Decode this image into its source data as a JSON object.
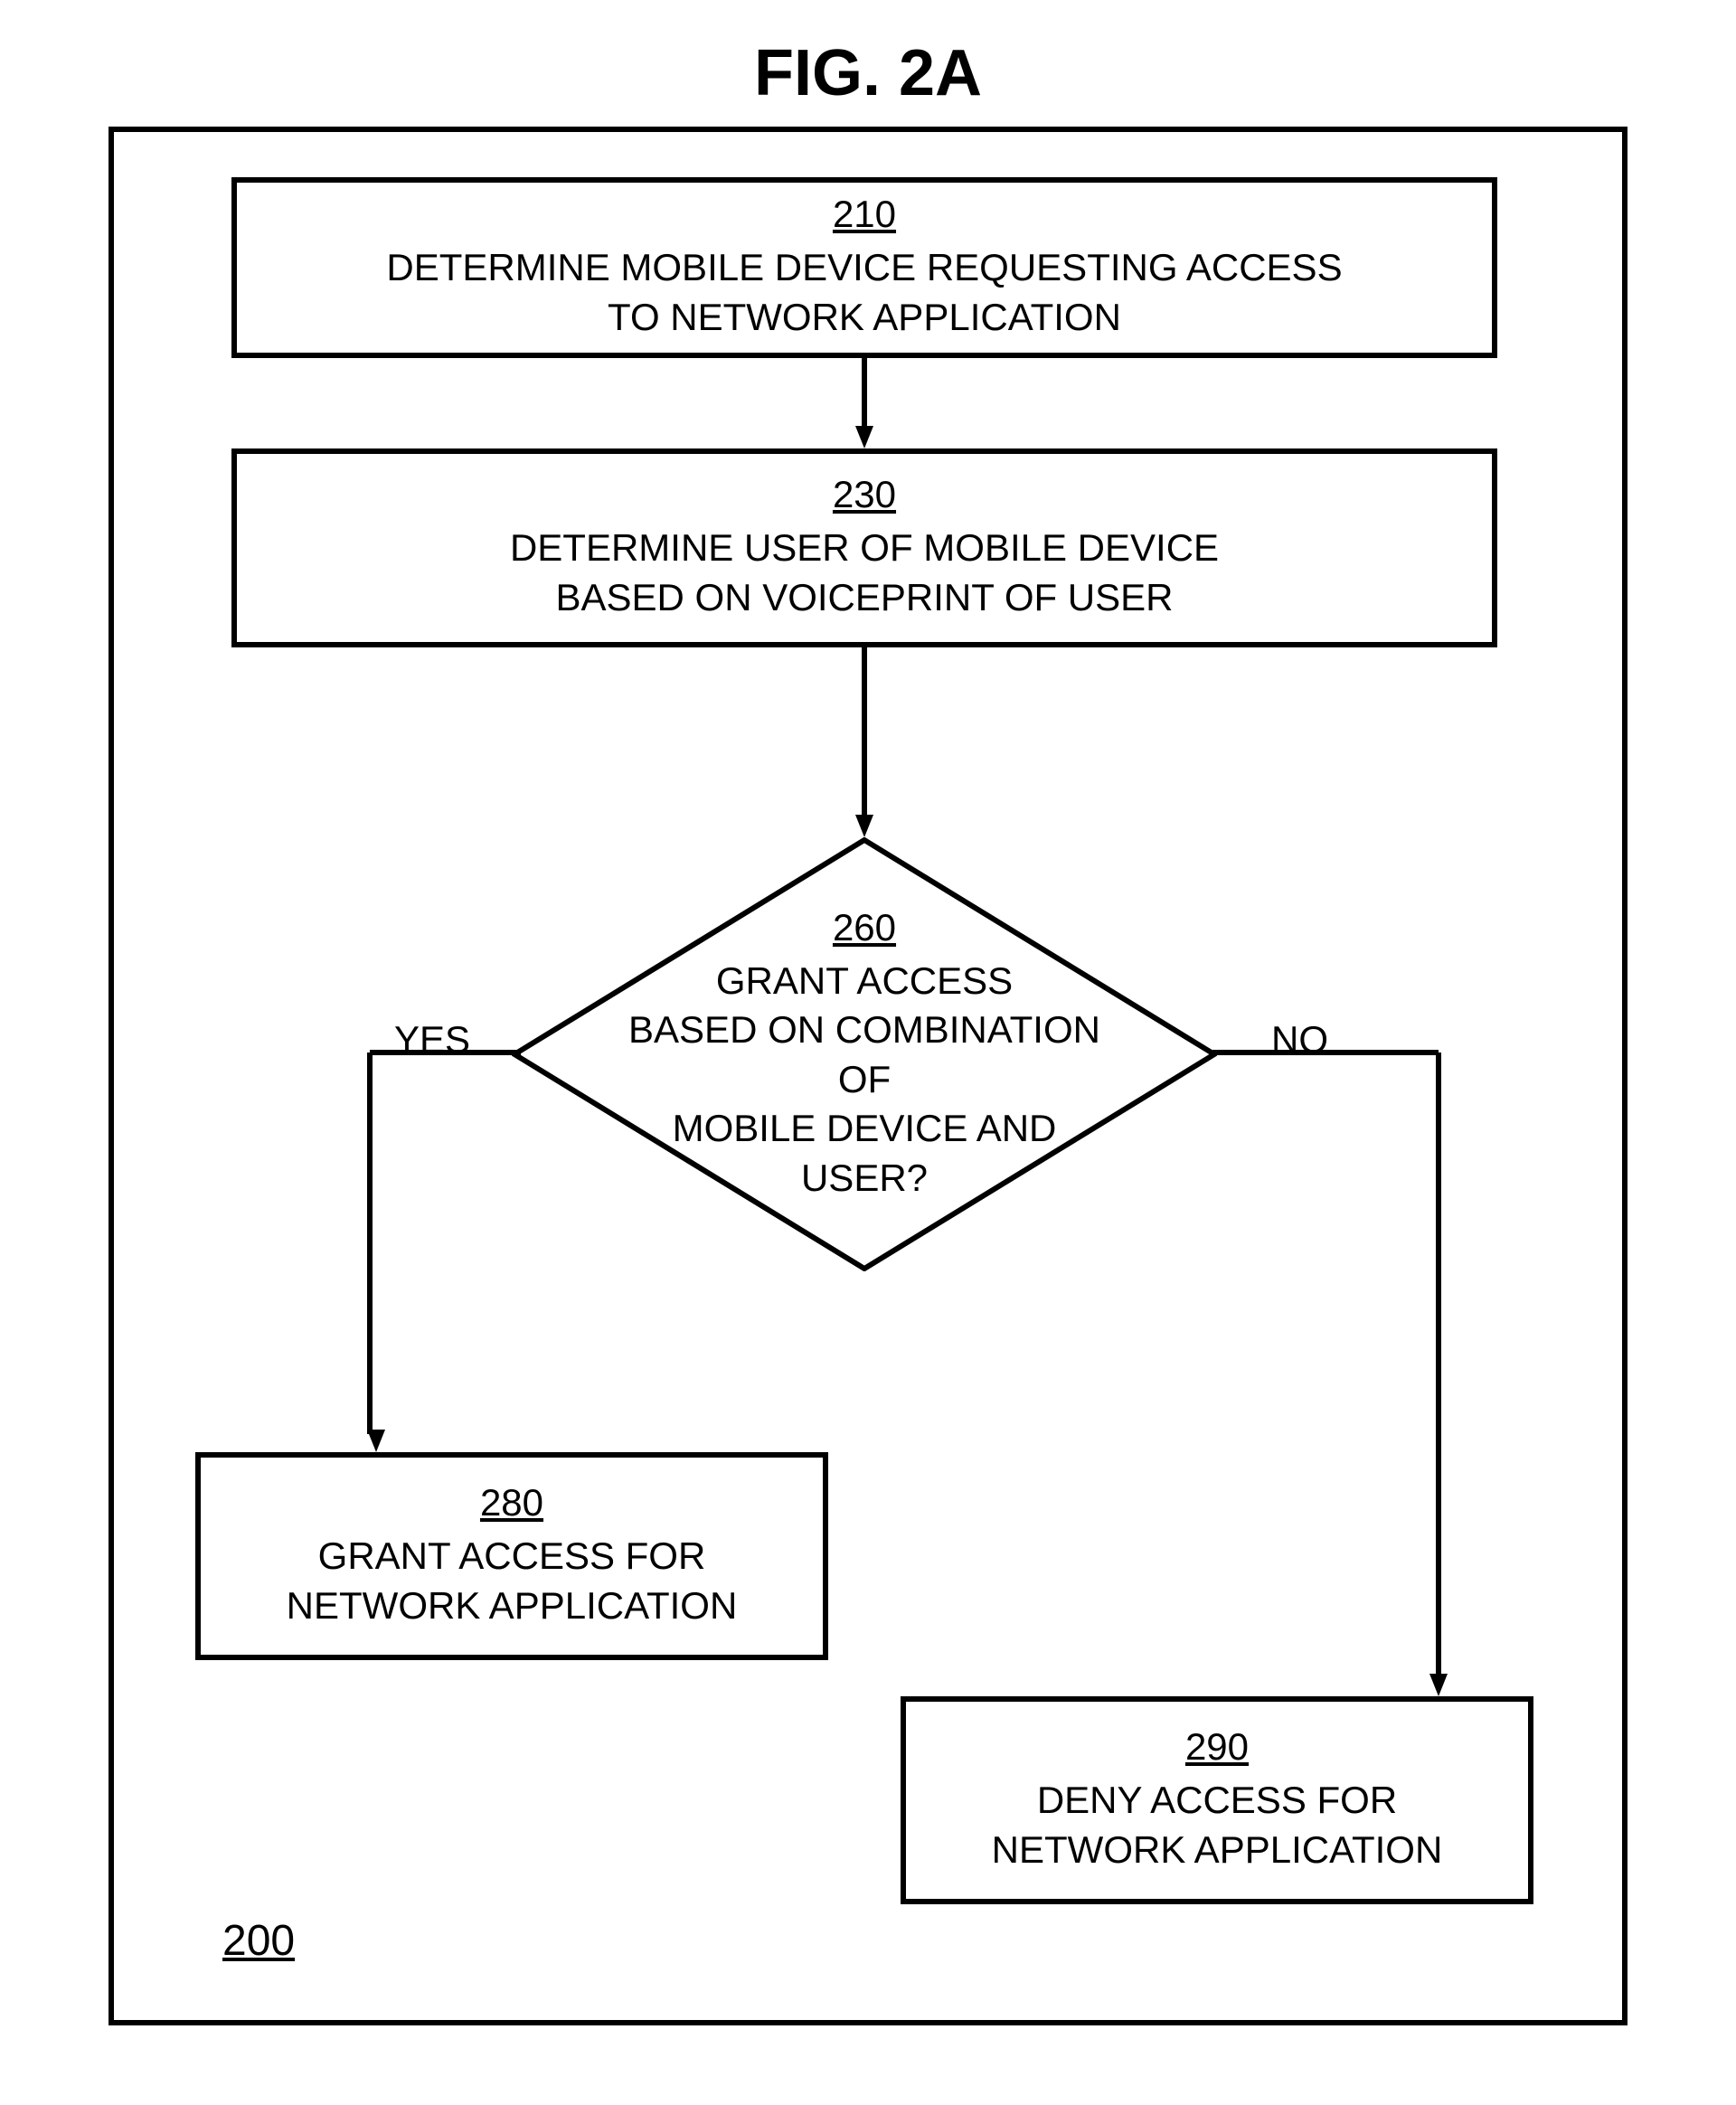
{
  "title": "FIG. 2A",
  "figure_ref": "200",
  "boxes": {
    "b210": {
      "ref": "210",
      "text": "DETERMINE MOBILE DEVICE REQUESTING ACCESS\nTO NETWORK APPLICATION"
    },
    "b230": {
      "ref": "230",
      "text": "DETERMINE USER OF MOBILE DEVICE\nBASED ON VOICEPRINT OF USER"
    },
    "b260": {
      "ref": "260",
      "text": "GRANT ACCESS\nBASED ON COMBINATION OF\nMOBILE DEVICE AND\nUSER?"
    },
    "b280": {
      "ref": "280",
      "text": "GRANT ACCESS FOR\nNETWORK APPLICATION"
    },
    "b290": {
      "ref": "290",
      "text": "DENY ACCESS FOR\nNETWORK APPLICATION"
    }
  },
  "labels": {
    "yes": "YES",
    "no": "NO"
  },
  "chart_data": {
    "type": "flowchart",
    "nodes": [
      {
        "id": "210",
        "type": "process",
        "label": "DETERMINE MOBILE DEVICE REQUESTING ACCESS TO NETWORK APPLICATION"
      },
      {
        "id": "230",
        "type": "process",
        "label": "DETERMINE USER OF MOBILE DEVICE BASED ON VOICEPRINT OF USER"
      },
      {
        "id": "260",
        "type": "decision",
        "label": "GRANT ACCESS BASED ON COMBINATION OF MOBILE DEVICE AND USER?"
      },
      {
        "id": "280",
        "type": "process",
        "label": "GRANT ACCESS FOR NETWORK APPLICATION"
      },
      {
        "id": "290",
        "type": "process",
        "label": "DENY ACCESS FOR NETWORK APPLICATION"
      }
    ],
    "edges": [
      {
        "from": "210",
        "to": "230",
        "label": ""
      },
      {
        "from": "230",
        "to": "260",
        "label": ""
      },
      {
        "from": "260",
        "to": "280",
        "label": "YES"
      },
      {
        "from": "260",
        "to": "290",
        "label": "NO"
      }
    ],
    "figure_number": "200",
    "title": "FIG. 2A"
  }
}
